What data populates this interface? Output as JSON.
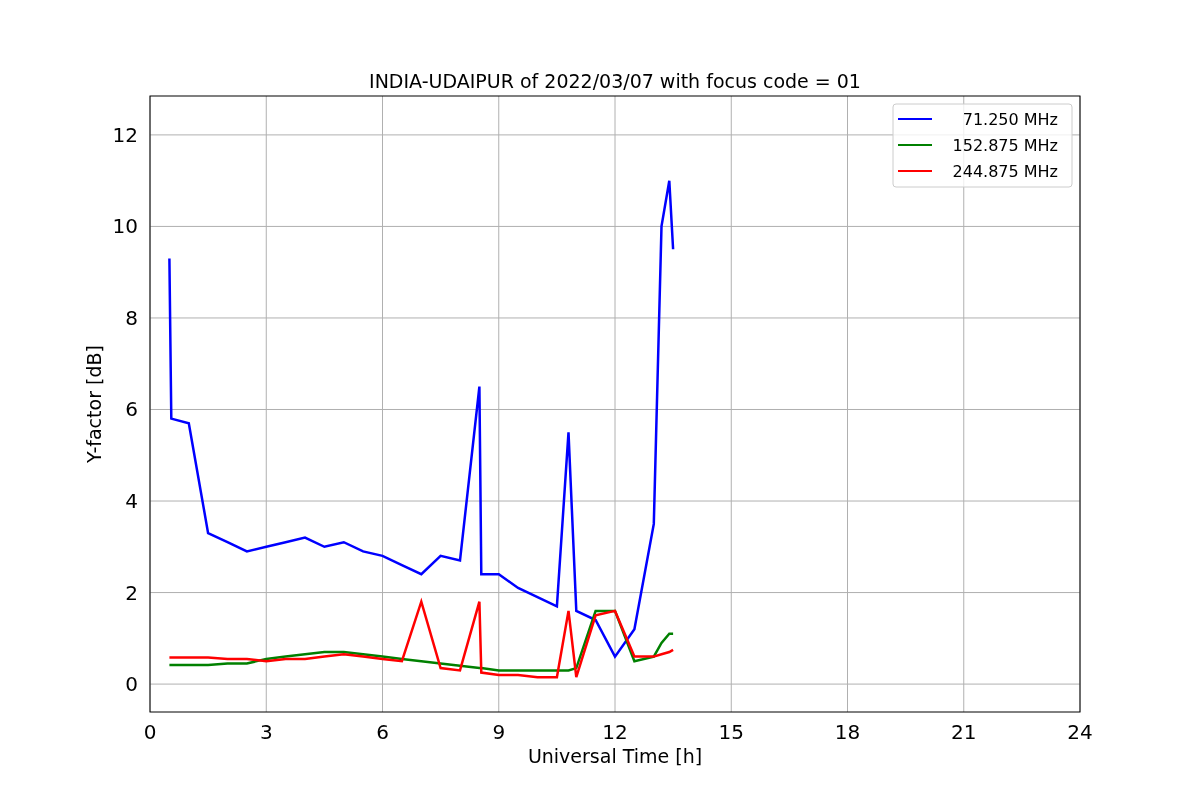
{
  "chart_data": {
    "type": "line",
    "title": "INDIA-UDAIPUR of 2022/03/07 with focus code = 01",
    "xlabel": "Universal Time [h]",
    "ylabel": "Y-factor [dB]",
    "x": [
      0.5,
      0.55,
      1,
      1.5,
      2,
      2.5,
      3,
      3.5,
      4,
      4.5,
      5,
      5.5,
      6,
      6.5,
      7,
      7.5,
      8,
      8.5,
      8.55,
      9,
      9.5,
      10,
      10.5,
      10.8,
      11,
      11.5,
      12,
      12.5,
      13,
      13.2,
      13.4,
      13.5
    ],
    "series": [
      {
        "name": " 71.250 MHz",
        "color": "#0000ff",
        "values": [
          9.3,
          5.8,
          5.7,
          3.3,
          3.1,
          2.9,
          3.0,
          3.1,
          3.2,
          3.0,
          3.1,
          2.9,
          2.8,
          2.6,
          2.4,
          2.8,
          2.7,
          6.5,
          2.4,
          2.4,
          2.1,
          1.9,
          1.7,
          5.5,
          1.6,
          1.4,
          0.6,
          1.2,
          3.5,
          10,
          11,
          9.5
        ]
      },
      {
        "name": "152.875 MHz",
        "color": "#008000",
        "values": [
          0.42,
          0.42,
          0.42,
          0.42,
          0.45,
          0.45,
          0.55,
          0.6,
          0.65,
          0.7,
          0.7,
          0.65,
          0.6,
          0.55,
          0.5,
          0.45,
          0.4,
          0.35,
          0.35,
          0.3,
          0.3,
          0.3,
          0.3,
          0.3,
          0.35,
          1.6,
          1.6,
          0.5,
          0.6,
          0.9,
          1.1,
          1.1
        ]
      },
      {
        "name": "244.875 MHz",
        "color": "#ff0000",
        "values": [
          0.58,
          0.58,
          0.58,
          0.58,
          0.55,
          0.55,
          0.5,
          0.55,
          0.55,
          0.6,
          0.65,
          0.6,
          0.55,
          0.5,
          1.8,
          0.35,
          0.3,
          1.8,
          0.25,
          0.2,
          0.2,
          0.15,
          0.15,
          1.6,
          0.15,
          1.5,
          1.6,
          0.6,
          0.6,
          0.65,
          0.7,
          0.75
        ]
      }
    ],
    "xlim": [
      0,
      24
    ],
    "ylim": [
      -0.61,
      12.85
    ],
    "xticks": [
      0,
      3,
      6,
      9,
      12,
      15,
      18,
      21,
      24
    ],
    "yticks": [
      0,
      2,
      4,
      6,
      8,
      10,
      12
    ],
    "grid": true,
    "legend": true
  }
}
